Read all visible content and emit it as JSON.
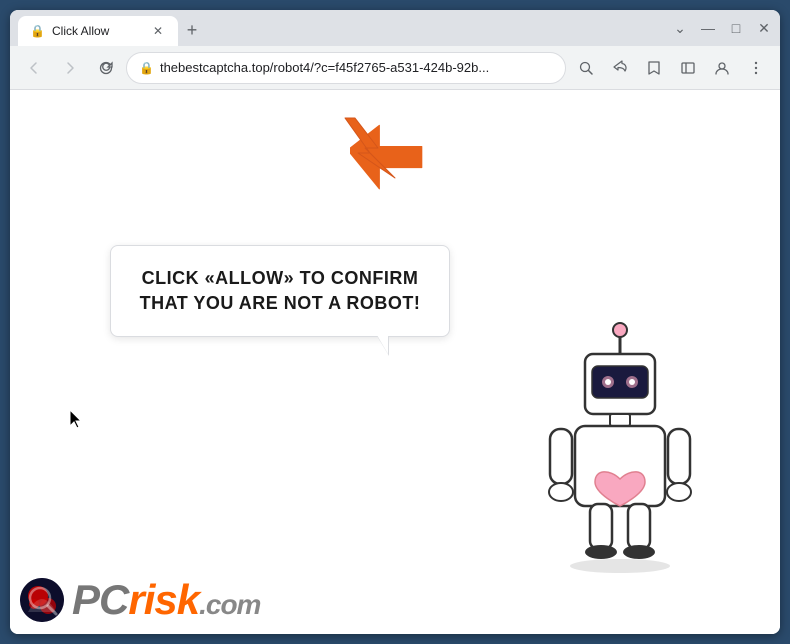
{
  "browser": {
    "tab": {
      "title": "Click Allow",
      "favicon": "🔒"
    },
    "url": "thebestcaptcha.top/robot4/?c=f45f2765-a531-424b-92b...",
    "new_tab_label": "+",
    "controls": {
      "minimize": "—",
      "maximize": "□",
      "close": "✕"
    },
    "nav": {
      "back": "‹",
      "forward": "›",
      "reload": "✕"
    }
  },
  "page": {
    "bubble_text": "CLICK «ALLOW» TO CONFIRM THAT YOU ARE NOT A ROBOT!",
    "arrow_color": "#E8621A"
  },
  "watermark": {
    "text_pc": "PC",
    "text_risk": "risk",
    "text_dot": ".",
    "text_com": "com"
  }
}
